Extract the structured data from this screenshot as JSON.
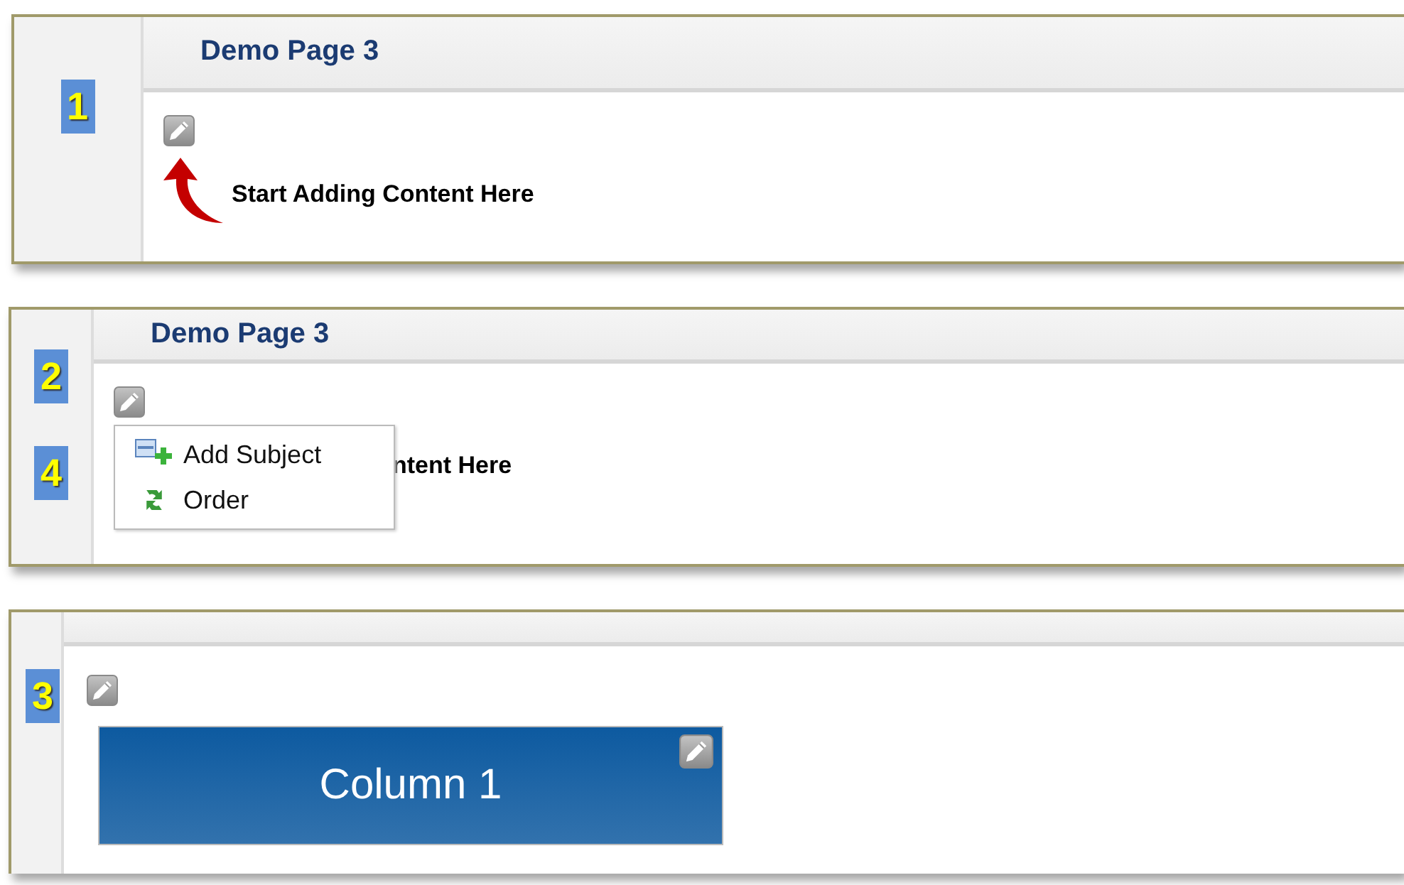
{
  "panels": [
    {
      "kind": "intro",
      "steps": [
        "1"
      ],
      "title": "Demo Page 3",
      "hint": "Start Adding Content Here"
    },
    {
      "kind": "menu",
      "steps": [
        "2",
        "4"
      ],
      "title": "Demo Page 3",
      "hint": "ntent Here",
      "menu": [
        {
          "label": "Add Subject"
        },
        {
          "label": "Order"
        }
      ]
    },
    {
      "kind": "column",
      "steps": [
        "3"
      ],
      "column": {
        "title": "Column 1"
      }
    }
  ]
}
